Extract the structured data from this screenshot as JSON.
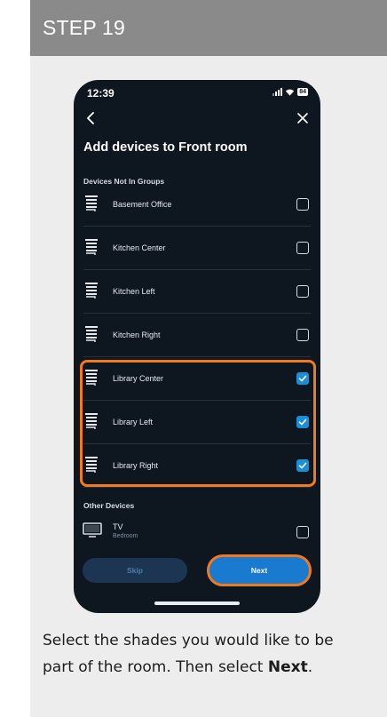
{
  "step": {
    "title": "STEP 19"
  },
  "status_bar": {
    "time": "12:39",
    "battery": "84",
    "icons": [
      "signal-icon",
      "wifi-icon",
      "battery-icon"
    ]
  },
  "nav": {
    "back_icon": "chevron-left-icon",
    "close_icon": "close-icon"
  },
  "page": {
    "title": "Add devices to Front room"
  },
  "sections": {
    "not_in_groups": "Devices Not In Groups",
    "other_devices": "Other Devices"
  },
  "devices": [
    {
      "name": "Basement Office",
      "checked": false,
      "icon": "shade-icon"
    },
    {
      "name": "Kitchen Center",
      "checked": false,
      "icon": "shade-icon"
    },
    {
      "name": "Kitchen Left",
      "checked": false,
      "icon": "shade-icon"
    },
    {
      "name": "Kitchen Right",
      "checked": false,
      "icon": "shade-icon"
    },
    {
      "name": "Library Center",
      "checked": true,
      "icon": "shade-icon"
    },
    {
      "name": "Library Left",
      "checked": true,
      "icon": "shade-icon"
    },
    {
      "name": "Library Right",
      "checked": true,
      "icon": "shade-icon"
    }
  ],
  "other_devices": [
    {
      "name": "TV",
      "subtitle": "Bedroom",
      "checked": false,
      "icon": "tv-icon"
    }
  ],
  "buttons": {
    "skip": "Skip",
    "next": "Next"
  },
  "caption": {
    "text": "Select the shades you would like to be part of the room. Then select ",
    "emphasis": "Next",
    "end": "."
  },
  "colors": {
    "accent": "#1a8fd8",
    "highlight": "#f37a1c",
    "header": "#8a8a8a",
    "phone_bg": "#0e1620"
  }
}
